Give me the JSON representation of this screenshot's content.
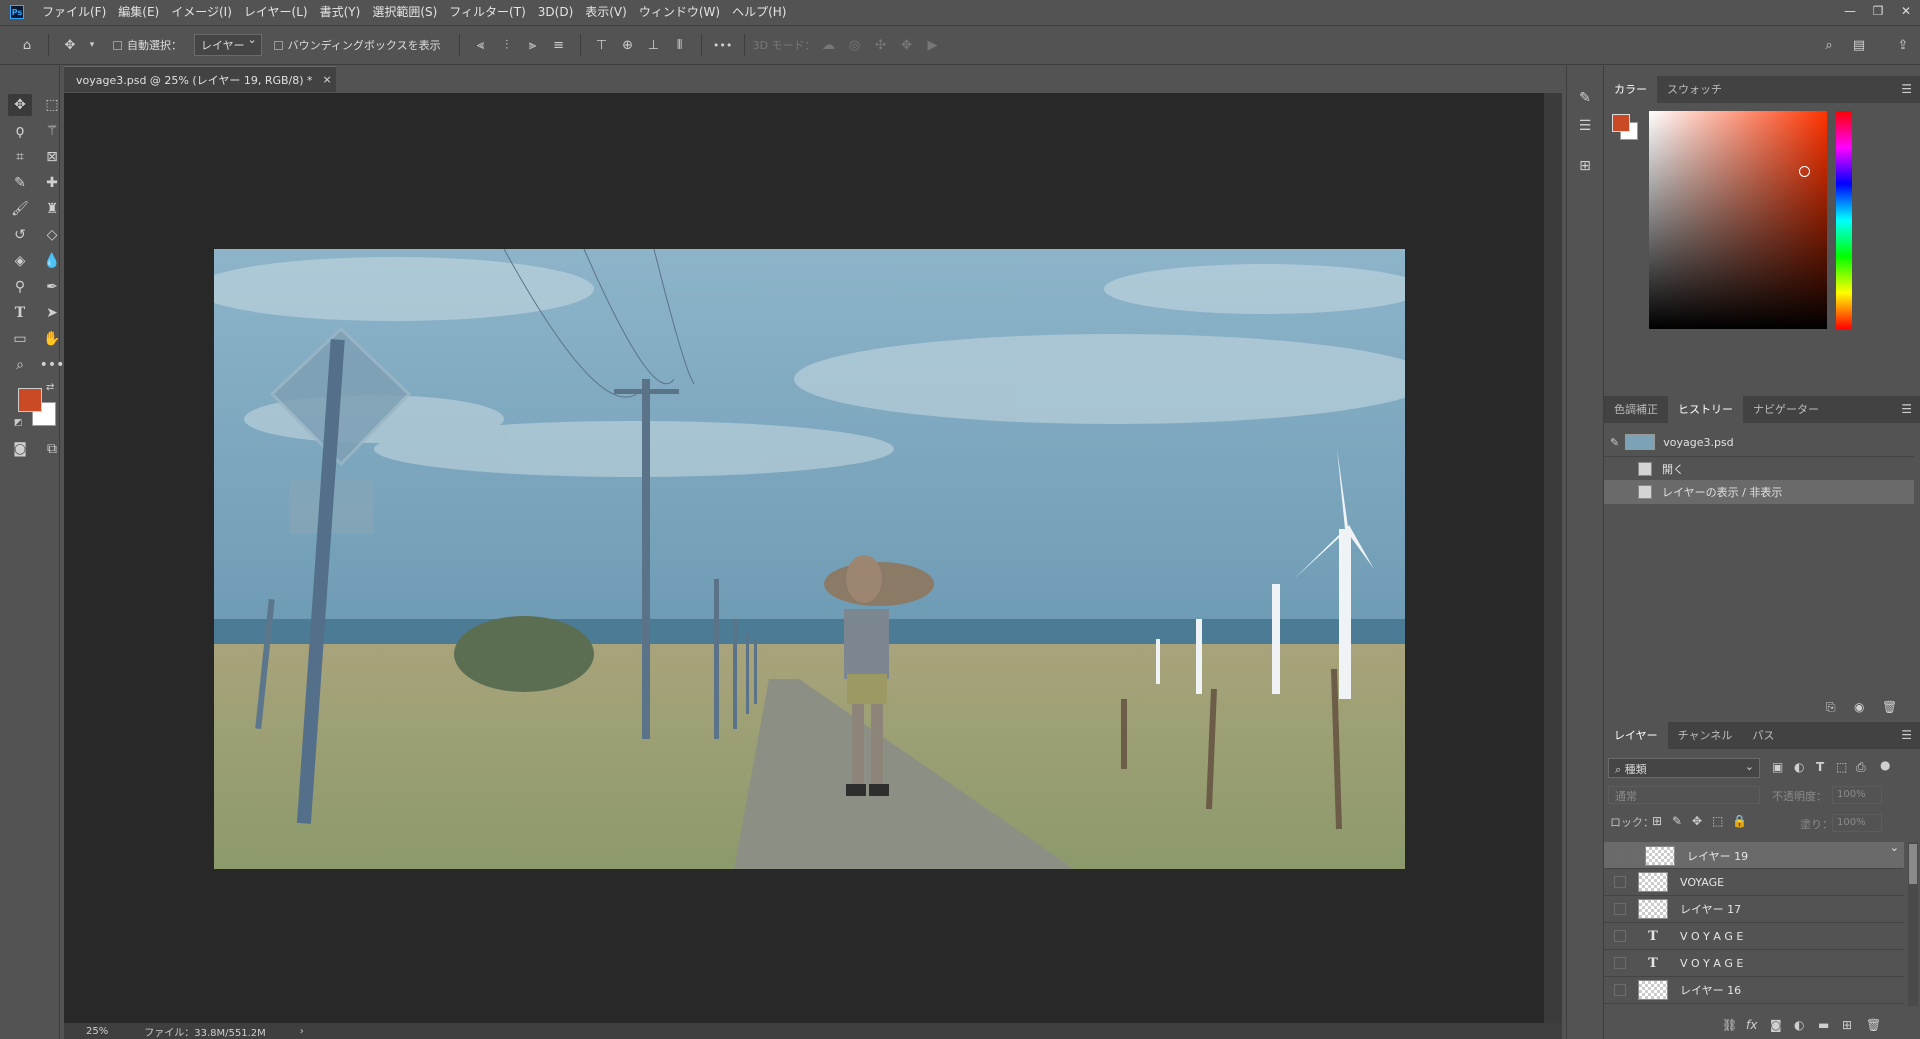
{
  "app": {
    "logo": "Ps"
  },
  "menu": [
    "ファイル(F)",
    "編集(E)",
    "イメージ(I)",
    "レイヤー(L)",
    "書式(Y)",
    "選択範囲(S)",
    "フィルター(T)",
    "3D(D)",
    "表示(V)",
    "ウィンドウ(W)",
    "ヘルプ(H)"
  ],
  "window_controls": {
    "minimize": "—",
    "restore": "❐",
    "close": "✕"
  },
  "options": {
    "auto_select_label": "自動選択：",
    "auto_select_target": "レイヤー",
    "bounding_box_label": "バウンディングボックスを表示",
    "more": "•••",
    "mode_3d_label": "3D モード："
  },
  "document": {
    "tab_title": "voyage3.psd @ 25% (レイヤー 19, RGB/8) *",
    "tab_close": "×",
    "zoom": "25%",
    "file_info": "ファイル：33.8M/551.2M",
    "status_arrow": "›"
  },
  "colors": {
    "foreground": "#c94a25",
    "background": "#ffffff",
    "picker_hue": "#ff3300",
    "accent": "#31a8ff"
  },
  "color_panel": {
    "tabs": [
      "カラー",
      "スウォッチ"
    ],
    "active_tab": 0
  },
  "history_panel": {
    "tabs": [
      "色調補正",
      "ヒストリー",
      "ナビゲーター"
    ],
    "active_tab": 1,
    "snapshot": "voyage3.psd",
    "states": [
      "開く",
      "レイヤーの表示 / 非表示"
    ]
  },
  "layers_panel": {
    "tabs": [
      "レイヤー",
      "チャンネル",
      "パス"
    ],
    "active_tab": 0,
    "filter_kind": "種類",
    "blend_mode": "通常",
    "opacity_label": "不透明度：",
    "opacity_value": "100%",
    "lock_label": "ロック：",
    "fill_label": "塗り：",
    "fill_value": "100%",
    "layers": [
      {
        "name": "レイヤー 19",
        "type": "pixel",
        "selected": true
      },
      {
        "name": "VOYAGE",
        "type": "pixel",
        "selected": false
      },
      {
        "name": "レイヤー 17",
        "type": "pixel",
        "selected": false
      },
      {
        "name": "V O Y A G E",
        "type": "text",
        "selected": false
      },
      {
        "name": "V O Y A G E",
        "type": "text",
        "selected": false
      },
      {
        "name": "レイヤー 16",
        "type": "pixel",
        "selected": false
      }
    ],
    "text_glyph": "T"
  }
}
